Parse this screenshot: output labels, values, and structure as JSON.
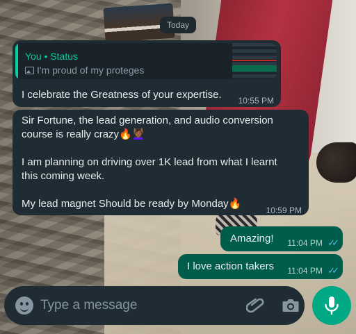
{
  "date_chip": "Today",
  "reply": {
    "sender": "You • Status",
    "status_text": "I'm proud of my proteges",
    "message": "I celebrate the Greatness of your expertise.",
    "time": "10:55 PM"
  },
  "message2": {
    "lines": [
      "Sir Fortune, the lead generation, and audio conversion",
      "course is really crazy🔥💆🏾‍♀️",
      "",
      "I am planning on driving over 1K lead from what I learnt",
      "this coming week.",
      "",
      "My lead magnet Should be ready by Monday🔥"
    ],
    "time": "10:59 PM"
  },
  "sent": [
    {
      "text": "Amazing!",
      "time": "11:04 PM",
      "ticks": "✓✓"
    },
    {
      "text": "I love action takers",
      "time": "11:04 PM",
      "ticks": "✓✓"
    }
  ],
  "composer": {
    "placeholder": "Type a message",
    "emoji_icon": "emoji-icon",
    "attach_icon": "paperclip-icon",
    "camera_icon": "camera-icon",
    "mic_icon": "microphone-icon"
  },
  "colors": {
    "incoming_bubble": "#1f2c34",
    "outgoing_bubble": "#005c4b",
    "accent": "#00a884",
    "read_ticks": "#53bdeb"
  }
}
